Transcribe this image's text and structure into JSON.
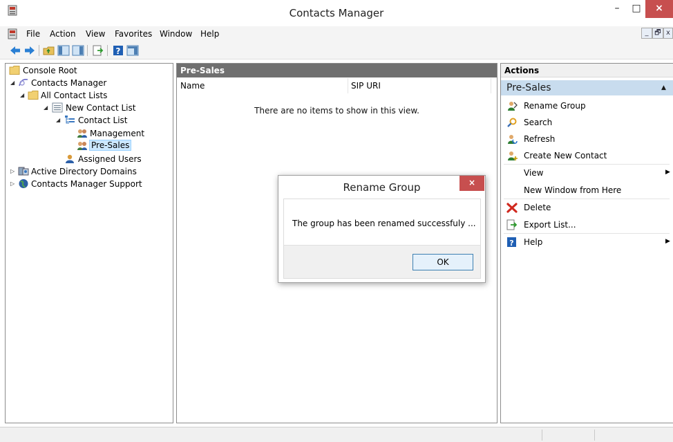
{
  "window": {
    "title": "Contacts Manager",
    "minimize_glyph": "–",
    "maximize_glyph": "□",
    "close_glyph": "×"
  },
  "menubar": {
    "items": [
      "File",
      "Action",
      "View",
      "Favorites",
      "Window",
      "Help"
    ],
    "mdi_minimize_glyph": "_",
    "mdi_restore_glyph": "🗗",
    "mdi_close_glyph": "x"
  },
  "toolbar": {
    "buttons": [
      "back-arrow-icon",
      "forward-arrow-icon",
      "up-folder-icon",
      "show-hide-tree-icon",
      "export-list-icon",
      "help-icon",
      "show-hide-action-pane-icon"
    ]
  },
  "tree": {
    "expanded_glyph": "◢",
    "collapsed_glyph": "▷",
    "items": [
      {
        "label": "Console Root",
        "icon": "folder-icon",
        "level": 0
      },
      {
        "label": "Contacts Manager",
        "icon": "contacts-manager-icon",
        "level": 1,
        "expander": "expanded"
      },
      {
        "label": "All Contact Lists",
        "icon": "folder-icon",
        "level": 2,
        "expander": "expanded"
      },
      {
        "label": "New Contact List",
        "icon": "list-icon",
        "level": 3,
        "expander": "expanded"
      },
      {
        "label": "Contact List",
        "icon": "tree-list-icon",
        "level": 4,
        "expander": "expanded"
      },
      {
        "label": "Management",
        "icon": "group-icon",
        "level": 5
      },
      {
        "label": "Pre-Sales",
        "icon": "group-icon",
        "level": 5,
        "selected": true
      },
      {
        "label": "Assigned Users",
        "icon": "users-icon",
        "level": 4
      },
      {
        "label": "Active Directory Domains",
        "icon": "directory-icon",
        "level": 1,
        "expander": "collapsed"
      },
      {
        "label": "Contacts Manager Support",
        "icon": "globe-icon",
        "level": 1,
        "expander": "collapsed"
      }
    ]
  },
  "center": {
    "header": "Pre-Sales",
    "columns": [
      "Name",
      "SIP URI"
    ],
    "empty_message": "There are no items to show in this view."
  },
  "actions": {
    "header": "Actions",
    "section": "Pre-Sales",
    "section_caret": "▲",
    "submenu_arrow": "▶",
    "items": [
      {
        "label": "Rename Group",
        "icon": "rename-group-icon"
      },
      {
        "label": "Search",
        "icon": "search-icon"
      },
      {
        "label": "Refresh",
        "icon": "refresh-icon"
      },
      {
        "label": "Create New Contact",
        "icon": "create-contact-icon"
      },
      {
        "label": "View",
        "icon": "",
        "submenu": true
      },
      {
        "label": "New Window from Here",
        "icon": ""
      },
      {
        "label": "Delete",
        "icon": "delete-icon"
      },
      {
        "label": "Export List...",
        "icon": "export-list-icon"
      },
      {
        "label": "Help",
        "icon": "help-icon",
        "submenu": true
      }
    ]
  },
  "dialog": {
    "title": "Rename Group",
    "close_glyph": "×",
    "message": "The group has been renamed successfuly ...",
    "ok_label": "OK"
  },
  "colors": {
    "close_red": "#c74f4f",
    "pane_header_gray": "#707070",
    "actions_section_blue": "#c8dcee",
    "selection_blue": "#cce8ff"
  }
}
